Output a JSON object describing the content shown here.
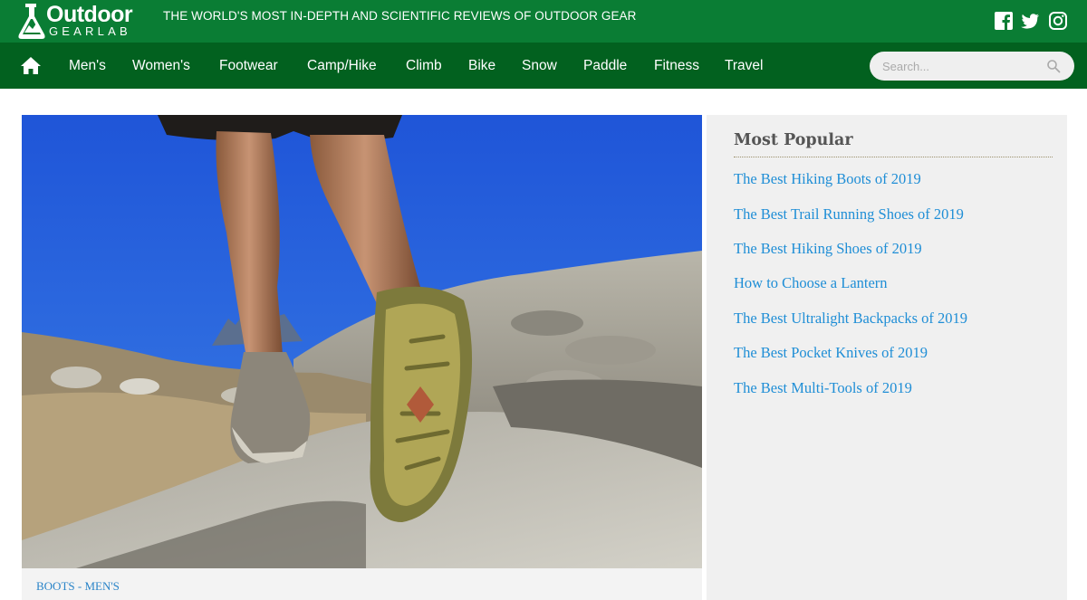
{
  "brand": {
    "name_top": "Outdoor",
    "name_bottom": "GEARLAB",
    "tagline": "THE WORLD'S MOST IN-DEPTH AND SCIENTIFIC REVIEWS OF OUTDOOR GEAR",
    "primary_color": "#0a7d34",
    "nav_color": "#02611f"
  },
  "social": [
    {
      "icon": "facebook-icon"
    },
    {
      "icon": "twitter-icon"
    },
    {
      "icon": "instagram-icon"
    }
  ],
  "nav": {
    "home_icon": "home-icon",
    "items": [
      "Men's",
      "Women's",
      "Footwear",
      "Camp/Hike",
      "Climb",
      "Bike",
      "Snow",
      "Paddle",
      "Fitness",
      "Travel"
    ]
  },
  "search": {
    "placeholder": "Search...",
    "value": ""
  },
  "article": {
    "category": "BOOTS - MEN'S"
  },
  "sidebar": {
    "title": "Most Popular",
    "links": [
      "The Best Hiking Boots of 2019",
      "The Best Trail Running Shoes of 2019",
      "The Best Hiking Shoes of 2019",
      "How to Choose a Lantern",
      "The Best Ultralight Backpacks of 2019",
      "The Best Pocket Knives of 2019",
      "The Best Multi-Tools of 2019"
    ],
    "link_color": "#1f8ed6"
  }
}
